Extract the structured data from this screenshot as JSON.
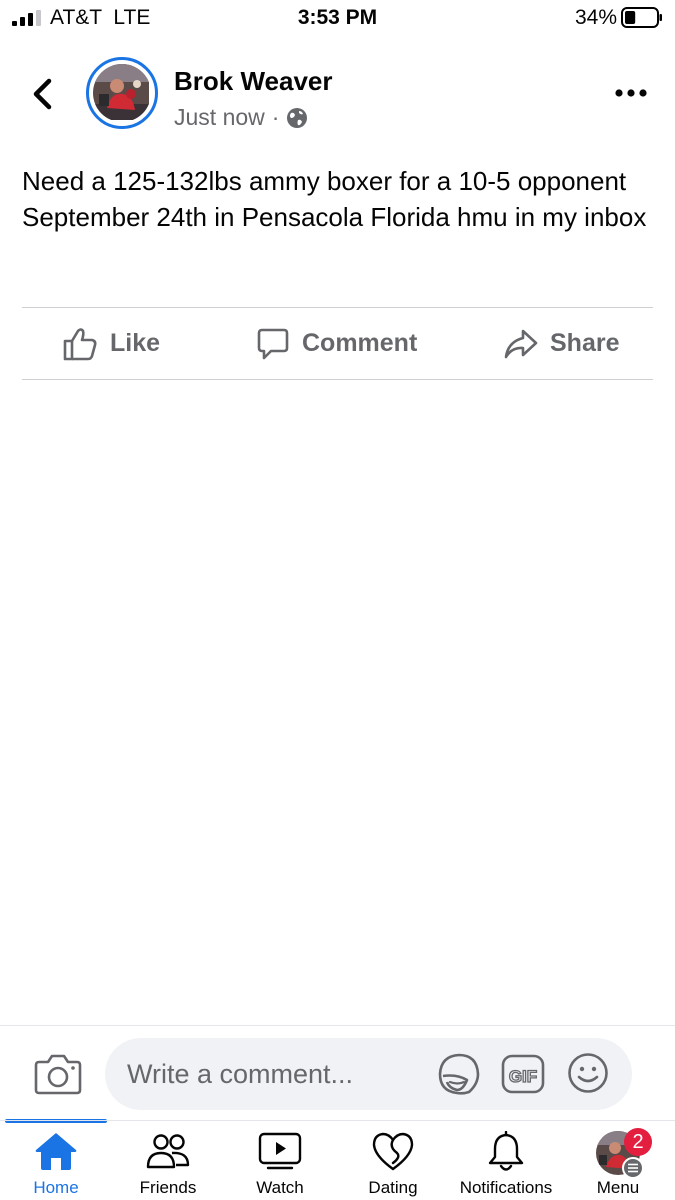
{
  "status_bar": {
    "carrier": "AT&T  LTE",
    "time": "3:53 PM",
    "battery": "34%",
    "battery_level": 0.34
  },
  "post": {
    "author": "Brok Weaver",
    "timestamp": "Just now",
    "separator": "·",
    "privacy_icon": "globe-icon",
    "text": "Need a 125-132lbs ammy boxer for a 10-5 opponent September 24th in Pensacola Florida hmu in my inbox"
  },
  "actions": {
    "like": "Like",
    "comment": "Comment",
    "share": "Share"
  },
  "composer": {
    "placeholder": "Write a comment...",
    "gif": "GIF"
  },
  "tabs": [
    {
      "label": "Home",
      "icon": "home-icon",
      "active": true
    },
    {
      "label": "Friends",
      "icon": "friends-icon",
      "active": false
    },
    {
      "label": "Watch",
      "icon": "watch-icon",
      "active": false
    },
    {
      "label": "Dating",
      "icon": "heart-icon",
      "active": false
    },
    {
      "label": "Notifications",
      "icon": "bell-icon",
      "active": false
    },
    {
      "label": "Menu",
      "icon": "menu-avatar",
      "active": false
    }
  ],
  "menu_badge": "2",
  "colors": {
    "accent": "#1b74e4",
    "secondary_text": "#65676b",
    "badge": "#e41e3f"
  }
}
